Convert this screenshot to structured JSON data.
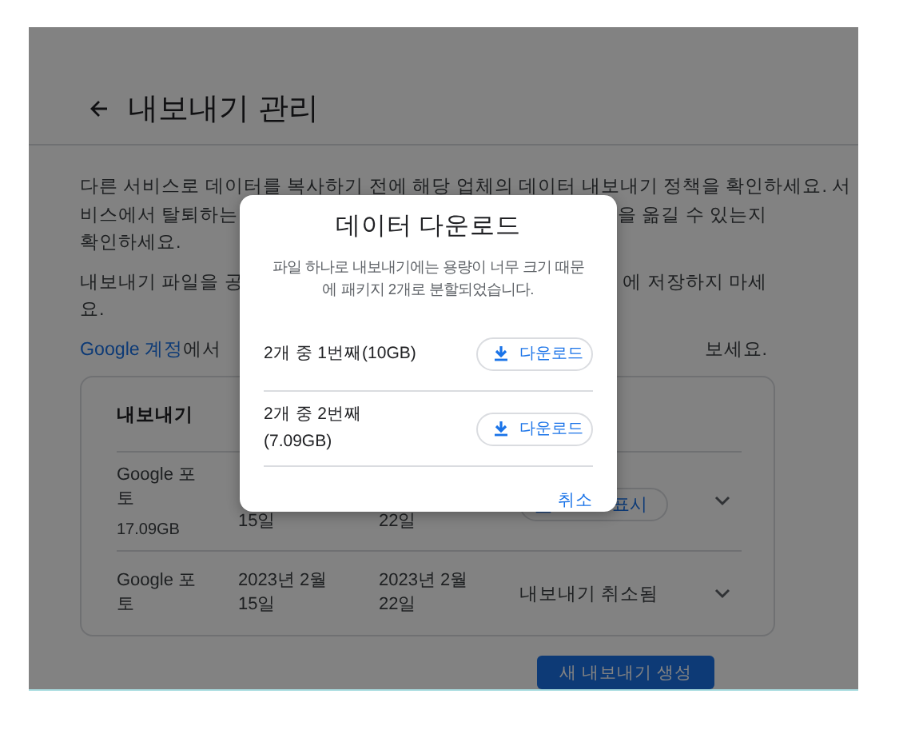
{
  "page": {
    "title": "내보내기 관리",
    "paragraphs": [
      {
        "lines": [
          {
            "left": "다른 서비스로 데이터를 복사하기 전에 해당 업체의 데이터 내보내기 정책을 확인하세요. 서"
          },
          {
            "left": "비스에서 탈퇴하는",
            "right": "을 옮길 수 있는지"
          },
          {
            "left": "확인하세요."
          }
        ]
      },
      {
        "lines": [
          {
            "left": "내보내기 파일을 공",
            "right": "에 저장하지 마세"
          },
          {
            "left": "요."
          }
        ]
      },
      {
        "lines": [
          {
            "link": "Google 계정",
            "left": "에서",
            "right": "보세요."
          }
        ]
      }
    ],
    "table": {
      "columns": [
        "내보내기"
      ],
      "rows": [
        {
          "name": "Google 포토",
          "size": "17.09GB",
          "created": "15일",
          "expires": "22일",
          "status": {
            "kind": "button",
            "label": "표시"
          }
        },
        {
          "name": "Google 포토",
          "created": "2023년 2월 15일",
          "expires": "2023년 2월 22일",
          "status": {
            "kind": "text",
            "label": "내보내기 취소됨"
          }
        }
      ]
    },
    "create_button": "새 내보내기 생성"
  },
  "dialog": {
    "title": "데이터 다운로드",
    "message": "파일 하나로 내보내기에는 용량이 너무 크기 때문\n에 패키지 2개로 분할되었습니다.",
    "parts": [
      {
        "label": "2개 중 1번째(10GB)",
        "button": "다운로드"
      },
      {
        "label": "2개 중 2번째\n(7.09GB)",
        "button": "다운로드"
      }
    ],
    "cancel": "취소"
  }
}
